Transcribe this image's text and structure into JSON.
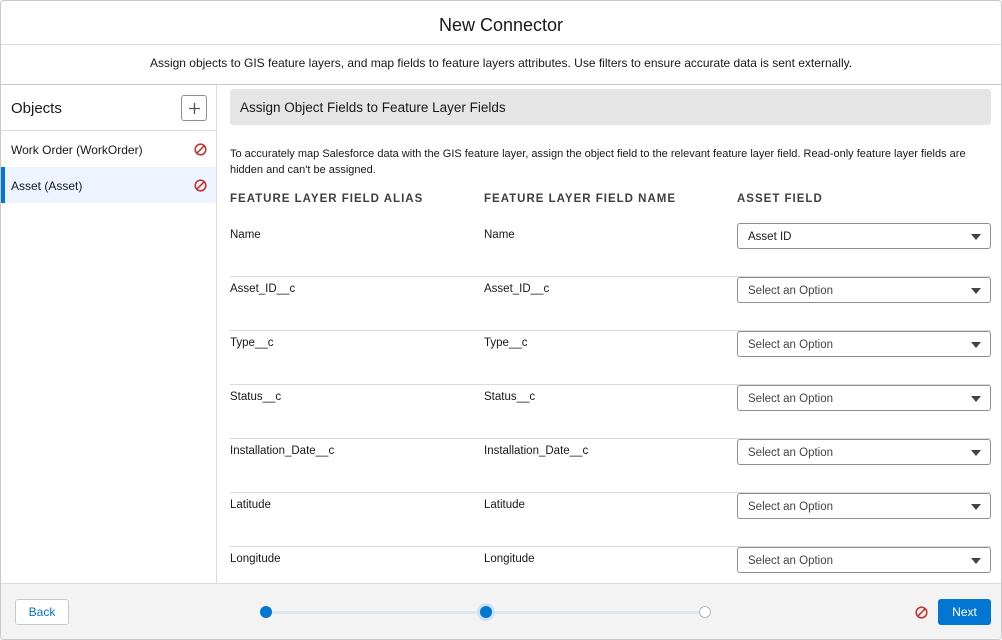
{
  "header": {
    "title": "New Connector"
  },
  "subheader": {
    "text": "Assign objects to GIS feature layers, and map fields to feature layers attributes. Use filters to ensure accurate data is sent externally."
  },
  "sidebar": {
    "title": "Objects",
    "items": [
      {
        "label": "Work Order (WorkOrder)",
        "active": false
      },
      {
        "label": "Asset (Asset)",
        "active": true
      }
    ]
  },
  "main": {
    "section_title": "Assign Object Fields to Feature Layer Fields",
    "help_text": "To accurately map Salesforce data with the GIS feature layer, assign the object field to the relevant feature layer field. Read-only feature layer fields are hidden and can't be assigned.",
    "columns": [
      "FEATURE LAYER FIELD ALIAS",
      "FEATURE LAYER FIELD NAME",
      "ASSET FIELD"
    ],
    "rows": [
      {
        "alias": "Name",
        "name": "Name",
        "value": "Asset ID"
      },
      {
        "alias": "Asset_ID__c",
        "name": "Asset_ID__c",
        "value": "Select an Option"
      },
      {
        "alias": "Type__c",
        "name": "Type__c",
        "value": "Select an Option"
      },
      {
        "alias": "Status__c",
        "name": "Status__c",
        "value": "Select an Option"
      },
      {
        "alias": "Installation_Date__c",
        "name": "Installation_Date__c",
        "value": "Select an Option"
      },
      {
        "alias": "Latitude",
        "name": "Latitude",
        "value": "Select an Option"
      },
      {
        "alias": "Longitude",
        "name": "Longitude",
        "value": "Select an Option"
      }
    ]
  },
  "footer": {
    "back_label": "Back",
    "next_label": "Next",
    "progress": {
      "total_steps": 3,
      "current_step": 2
    }
  },
  "colors": {
    "brand": "#0176d3",
    "error": "#c23934",
    "section_bg": "#e5e5e5",
    "active_item_bg": "#eef4ff"
  }
}
